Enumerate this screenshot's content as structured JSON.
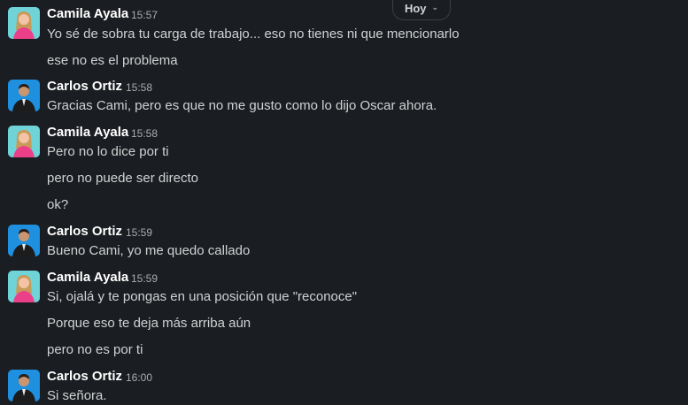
{
  "date_divider": {
    "label": "Hoy",
    "icon": "chevron-down-icon"
  },
  "colors": {
    "background": "#1a1d21",
    "name": "#ffffff",
    "text": "#d1d2d3",
    "timestamp": "#abadb0",
    "avatar_camila_bg": "#6fd3d8",
    "avatar_carlos_bg": "#1f8fe0"
  },
  "messages": [
    {
      "author": "Camila Ayala",
      "time": "15:57",
      "lines": [
        "Yo sé de sobra tu carga de trabajo... eso no tienes ni que mencionarlo",
        "ese no es el problema"
      ]
    },
    {
      "author": "Carlos Ortiz",
      "time": "15:58",
      "lines": [
        "Gracias Cami, pero es que no me gusto como lo dijo Oscar ahora."
      ]
    },
    {
      "author": "Camila Ayala",
      "time": "15:58",
      "lines": [
        "Pero no lo dice por ti",
        "pero no puede ser directo",
        "ok?"
      ]
    },
    {
      "author": "Carlos Ortiz",
      "time": "15:59",
      "lines": [
        "Bueno Cami, yo me quedo callado"
      ]
    },
    {
      "author": "Camila Ayala",
      "time": "15:59",
      "lines": [
        "Si, ojalá y te pongas en una posición que \"reconoce\"",
        "Porque eso te deja más arriba aún",
        "pero no es por ti"
      ]
    },
    {
      "author": "Carlos Ortiz",
      "time": "16:00",
      "lines": [
        "Si señora."
      ]
    }
  ]
}
